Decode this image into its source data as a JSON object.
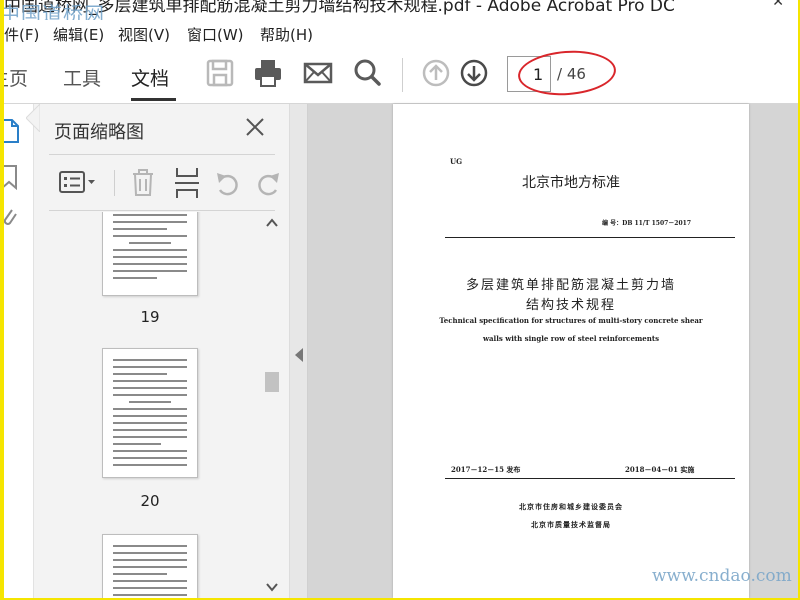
{
  "window": {
    "title": "中国道桥网_多层建筑单排配筋混凝土剪力墙结构技术规程.pdf - Adobe Acrobat Pro DC",
    "watermark_top": "中国道桥网",
    "watermark_bottom": "www.cndao.com"
  },
  "menu": {
    "items": [
      "件(F)",
      "编辑(E)",
      "视图(V)",
      "窗口(W)",
      "帮助(H)"
    ]
  },
  "toolbar": {
    "tabs": [
      "主页",
      "工具",
      "文档"
    ],
    "active_tab": "文档",
    "page_current": "1",
    "page_total": "/ 46",
    "icons": [
      "save-icon",
      "print-icon",
      "email-icon",
      "search-icon",
      "page-up-icon",
      "page-down-icon"
    ],
    "annotation_color": "#d9262b"
  },
  "panel": {
    "title": "页面缩略图",
    "tools": [
      "thumbnail-options-icon",
      "delete-icon",
      "extract-icon",
      "rotate-ccw-icon",
      "rotate-cw-icon"
    ],
    "thumbnails": [
      {
        "label": "19"
      },
      {
        "label": "20"
      },
      {
        "label": ""
      }
    ]
  },
  "document": {
    "ug": "UG",
    "standard_title": "北京市地方标准",
    "standard_no": "编 号：DB 11/T 1507－2017",
    "cn_title_line1": "多层建筑单排配筋混凝土剪力墙",
    "cn_title_line2": "结构技术规程",
    "en_title_line1": "Technical specification for structures of multi-story concrete shear",
    "en_title_line2": "walls with single row of steel reinforcements",
    "date_issue": "2017－12－15 发布",
    "date_effective": "2018－04－01 实施",
    "issuer1": "北京市住房和城乡建设委员会",
    "issuer2": "北京市质量技术监督局"
  }
}
